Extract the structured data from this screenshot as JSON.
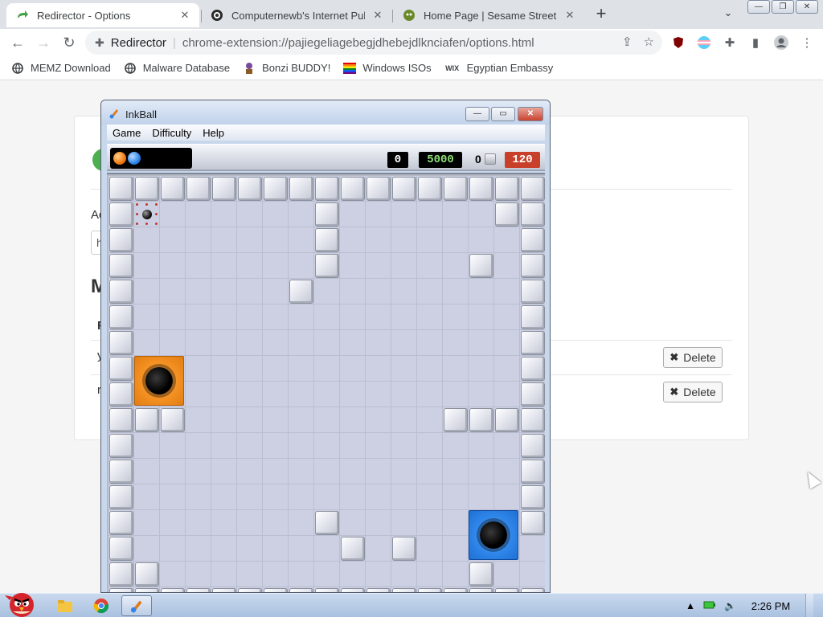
{
  "browser": {
    "tabs": [
      {
        "title": "Redirector - Options",
        "icon": "redirector-icon",
        "active": true
      },
      {
        "title": "Computernewb's Internet Pub",
        "icon": "computernewb-icon",
        "active": false
      },
      {
        "title": "Home Page | Sesame Street | F",
        "icon": "sesame-icon",
        "active": false
      }
    ],
    "new_tab": "+",
    "address": {
      "site": "Redirector",
      "url": "chrome-extension://pajiegeliagebegjdhebejdlknciafen/options.html"
    },
    "bookmarks": [
      {
        "label": "MEMZ Download",
        "icon": "globe-icon"
      },
      {
        "label": "Malware Database",
        "icon": "globe-icon"
      },
      {
        "label": "Bonzi BUDDY!",
        "icon": "bonzi-icon"
      },
      {
        "label": "Windows ISOs",
        "icon": "rainbow-flag-icon"
      },
      {
        "label": "Egyptian Embassy",
        "icon": "wix-icon"
      }
    ]
  },
  "page": {
    "fragments": {
      "f1": "Ad",
      "f2": "h",
      "f3": "M",
      "f4": "F",
      "f5": "y",
      "f6": "r"
    },
    "delete_label": "Delete"
  },
  "inkball": {
    "title": "InkBall",
    "menu": [
      "Game",
      "Difficulty",
      "Help"
    ],
    "status": {
      "balls_in_play": [
        "orange",
        "blue"
      ],
      "score_a": "0",
      "score_b": "5000",
      "blocks_label": "0",
      "timer": "120"
    },
    "grid": [
      "#################",
      "#.......#......##",
      "#.......#.......#",
      "#.......#.....#.#",
      "#......#........#",
      "#...............#",
      "#...............#",
      "#OO.............#",
      "#OO.............#",
      "###..........####",
      "#...............#",
      "#...............#",
      "#...............#",
      "#.......#.......#",
      "#........#.#...BB",
      "##............#BB",
      "#################"
    ],
    "grid_blocks_extra": [
      [
        1,
        8
      ],
      [
        1,
        15
      ],
      [
        2,
        9
      ],
      [
        3,
        9
      ],
      [
        3,
        11
      ],
      [
        4,
        10
      ],
      [
        5,
        13
      ],
      [
        6,
        13
      ],
      [
        13,
        11
      ],
      [
        14,
        12
      ],
      [
        14,
        14
      ],
      [
        15,
        11
      ]
    ],
    "holes": [
      {
        "color": "orange",
        "row": 7,
        "col": 1
      },
      {
        "color": "blue",
        "row": 13,
        "col": 14
      }
    ],
    "ball": {
      "row": 1,
      "col": 1
    }
  },
  "taskbar": {
    "time": "2:26 PM"
  }
}
